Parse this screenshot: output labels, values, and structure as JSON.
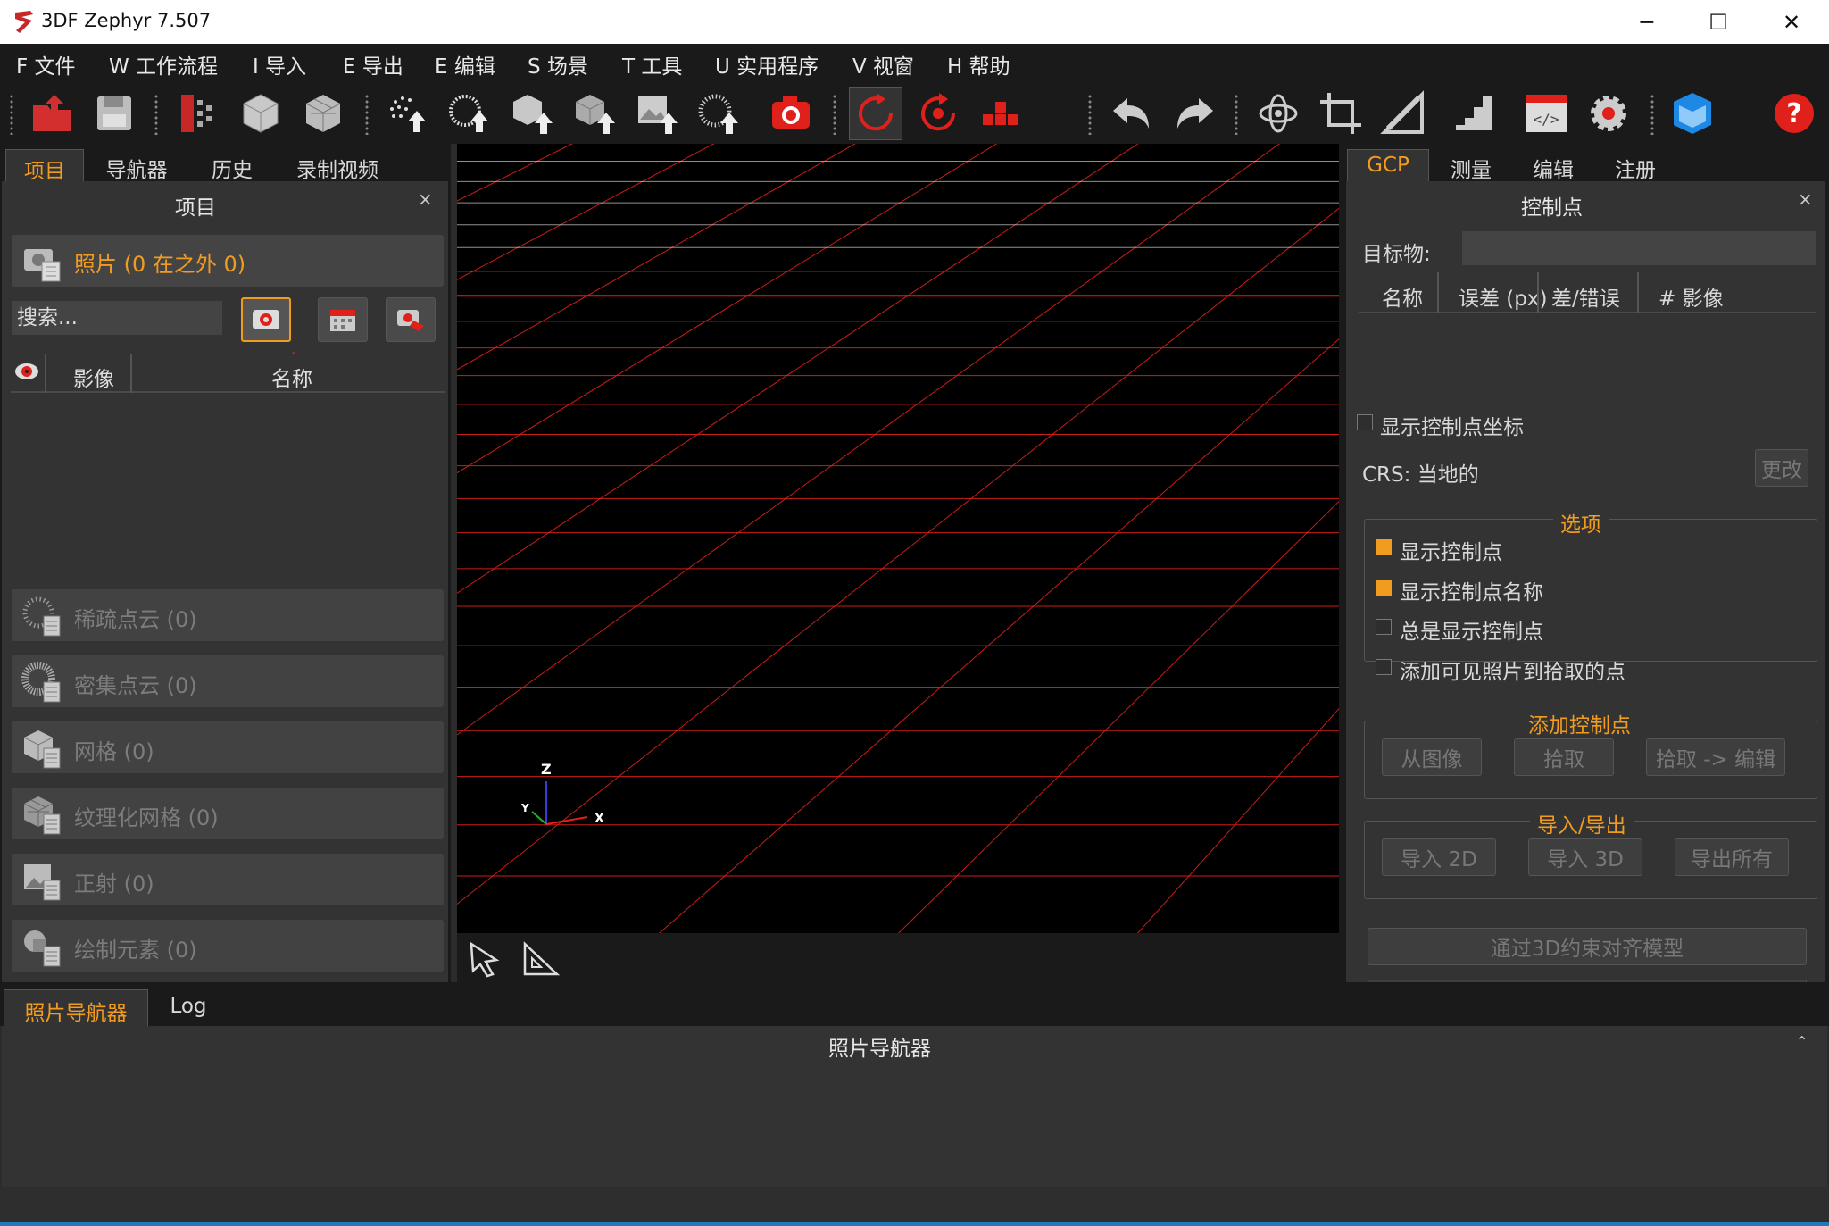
{
  "window": {
    "title": "3DF Zephyr 7.507",
    "minimize": "─",
    "maximize": "☐",
    "close": "✕"
  },
  "menu": [
    {
      "label": "F 文件"
    },
    {
      "label": "W 工作流程"
    },
    {
      "label": "I 导入"
    },
    {
      "label": "E 导出"
    },
    {
      "label": "E 编辑"
    },
    {
      "label": "S 场景"
    },
    {
      "label": "T 工具"
    },
    {
      "label": "U 实用程序"
    },
    {
      "label": "V 视窗"
    },
    {
      "label": "H 帮助"
    }
  ],
  "toolbar": {
    "icons": [
      "open-project-icon",
      "save-icon",
      "workflow-icon",
      "mesh-cube-icon",
      "textured-mesh-icon",
      "sparse-upload-icon",
      "dense-upload-icon",
      "mesh-upload-icon",
      "textured-upload-icon",
      "image-upload-icon",
      "point-upload-icon",
      "camera-icon",
      "rotate-icon",
      "record-icon",
      "wasd-keys-icon",
      "undo-icon",
      "redo-icon",
      "orbit-icon",
      "crop-icon",
      "measure-ruler-icon",
      "stairs-icon",
      "script-editor-icon",
      "settings-icon",
      "logo-icon",
      "help-icon"
    ]
  },
  "left_tabs": [
    {
      "label": "项目",
      "active": true
    },
    {
      "label": "导航器"
    },
    {
      "label": "历史"
    },
    {
      "label": "录制视频"
    }
  ],
  "project": {
    "title": "项目",
    "close": "×",
    "photos_label": "照片 (0 在之外 0)",
    "search_placeholder": "搜索...",
    "columns": {
      "image": "影像",
      "name": "名称"
    },
    "items": [
      {
        "label": "稀疏点云 (0)"
      },
      {
        "label": "密集点云 (0)"
      },
      {
        "label": "网格 (0)"
      },
      {
        "label": "纹理化网格 (0)"
      },
      {
        "label": "正射 (0)"
      },
      {
        "label": "绘制元素 (0)"
      }
    ]
  },
  "viewport": {
    "axes": {
      "z": "Z",
      "y": "Y",
      "x": "X"
    },
    "tools": [
      "select-arrow-icon",
      "set-square-icon"
    ],
    "grid_color": "#ffffff",
    "highlight_color": "#e0201b"
  },
  "right_tabs": [
    {
      "label": "GCP",
      "active": true
    },
    {
      "label": "测量"
    },
    {
      "label": "编辑"
    },
    {
      "label": "注册"
    }
  ],
  "gcp": {
    "title": "控制点",
    "close": "×",
    "target_label": "目标物:",
    "columns": {
      "name": "名称",
      "error": "误差 (px)",
      "error2": "差/错误 (",
      "images": "# 影像"
    },
    "show_coords": "显示控制点坐标",
    "crs_label": "CRS: 当地的",
    "change_btn": "更改",
    "options_title": "选项",
    "options": [
      {
        "label": "显示控制点",
        "checked": true
      },
      {
        "label": "显示控制点名称",
        "checked": true
      },
      {
        "label": "总是显示控制点",
        "checked": false
      },
      {
        "label": "添加可见照片到拾取的点",
        "checked": false
      }
    ],
    "add_title": "添加控制点",
    "add_buttons": {
      "from_image": "从图像",
      "pick": "拾取",
      "pick_edit": "拾取 -> 编辑"
    },
    "io_title": "导入/导出",
    "io_buttons": {
      "import2d": "导入 2D",
      "import3d": "导入 3D",
      "export_all": "导出所有"
    },
    "align_btn": "通过3D约束对齐模型"
  },
  "bottom_tabs": [
    {
      "label": "照片导航器",
      "active": true
    },
    {
      "label": "Log"
    }
  ],
  "bottom": {
    "title": "照片导航器",
    "collapse": "⌃"
  },
  "colors": {
    "accent": "#f29c1f",
    "brand_red": "#e0201b",
    "panel": "#333333",
    "dark": "#1a1a1a",
    "statusbar_line": "#1e7bb8"
  }
}
